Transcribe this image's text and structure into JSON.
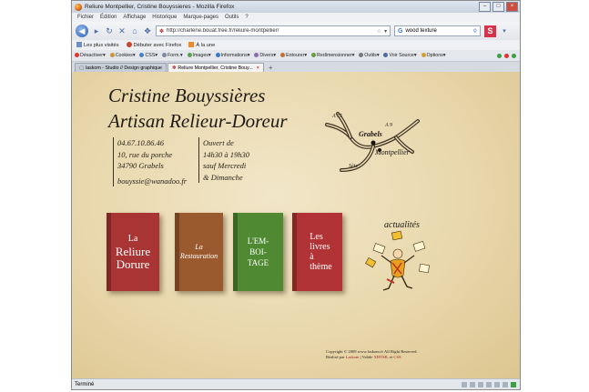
{
  "window": {
    "title": "Reliure Montpellier, Cristine Bouyssieres - Mozilla Firefox"
  },
  "menu": [
    "Fichier",
    "Édition",
    "Affichage",
    "Historique",
    "Marque-pages",
    "Outils",
    "?"
  ],
  "nav": {
    "url": "http://charlene.bouat.free.fr/reliure-montpellier/",
    "search": "wood texture"
  },
  "bookmarks": [
    "Les plus visités",
    "Débuter avec Firefox",
    "À la une"
  ],
  "devbar": [
    "Désactiver▾",
    "Cookies▾",
    "CSS▾",
    "Form.▾",
    "Images▾",
    "Informations▾",
    "Divers▾",
    "Entourer▾",
    "Redimensionner▾",
    "Outils▾",
    "Voir Source▾",
    "Options▾"
  ],
  "tabs": [
    {
      "label": "laskom - Studio // Design graphique",
      "active": false
    },
    {
      "label": "Reliure Montpellier, Cristine Bouy...",
      "active": true
    }
  ],
  "page": {
    "name": "Cristine Bouyssières",
    "subtitle": "Artisan Relieur-Doreur",
    "contact": {
      "phone": "04.67.10.86.46",
      "street": "10, rue du porche",
      "city": "34790 Grabels",
      "email": "bouyssie@wanadoo.fr"
    },
    "hours": [
      "Ouvert de",
      "14h30 à 19h30",
      "sauf Mercredi",
      "& Dimanche"
    ],
    "map": {
      "city_main": "Grabels",
      "city_secondary": "Montpellier",
      "road_a": "A 75",
      "road_b": "A 9",
      "road_c": "Sète"
    },
    "books": {
      "b1": {
        "line1": "La",
        "line2": "Reliure",
        "line3": "Dorure"
      },
      "b2": {
        "line1": "La",
        "line2": "Restauration"
      },
      "b3": {
        "line1": "L'EM-",
        "line2": "BOI-",
        "line3": "TAGE"
      },
      "b4": {
        "line1": "Les",
        "line2": "livres",
        "line3": "à",
        "line4": "thème"
      }
    },
    "news_title": "actualités",
    "footer": {
      "line1": "Copyright © 2009 www.laskom.fr All Right Reserved.",
      "line2_prefix": "Réalisé par",
      "line2_author": "Laskom",
      "line2_mid": "| Valide",
      "line2_xhtml": "XHTML",
      "line2_and": "et",
      "line2_css": "CSS"
    }
  },
  "status": {
    "text": "Terminé"
  }
}
